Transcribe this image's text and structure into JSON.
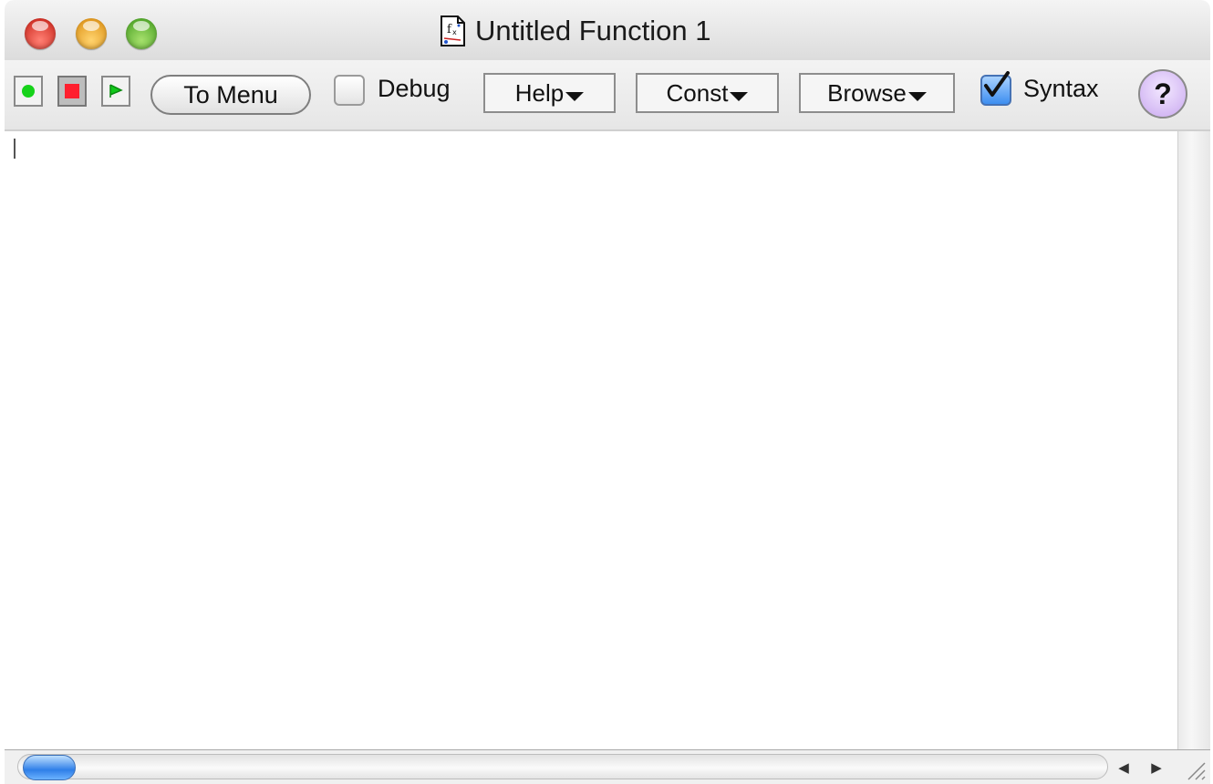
{
  "window": {
    "title": "Untitled Function 1",
    "doc_icon": "function-document-icon",
    "traffic_lights": [
      "close",
      "minimize",
      "zoom"
    ]
  },
  "toolbar": {
    "run_controls": [
      {
        "name": "record",
        "icon": "green-dot-icon",
        "color": "#16d21a"
      },
      {
        "name": "stop",
        "icon": "red-square-icon",
        "color": "#ff1f2e",
        "pressed": true
      },
      {
        "name": "play",
        "icon": "green-play-icon",
        "color": "#10c81a"
      }
    ],
    "to_menu_label": "To Menu",
    "debug": {
      "label": "Debug",
      "checked": false
    },
    "help_menu_label": "Help",
    "const_menu_label": "Const",
    "browse_menu_label": "Browse",
    "syntax": {
      "label": "Syntax",
      "checked": true
    },
    "help_button_label": "?"
  },
  "editor": {
    "content": ""
  },
  "scrollbars": {
    "horizontal_position": 0,
    "left_arrow": "◀",
    "right_arrow": "▶"
  }
}
